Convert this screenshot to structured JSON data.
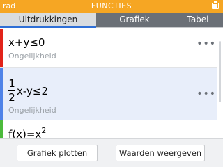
{
  "status": {
    "angle_mode": "rad",
    "app_title": "FUNCTIES",
    "battery_icon": "battery-icon"
  },
  "tabs": [
    {
      "label": "Uitdrukkingen",
      "active": true
    },
    {
      "label": "Grafiek",
      "active": false
    },
    {
      "label": "Tabel",
      "active": false
    }
  ],
  "expressions": [
    {
      "expression": "x+y≤0",
      "subtitle": "Ongelijkheid",
      "color": "#e2231a"
    },
    {
      "fraction": {
        "numerator": "1",
        "denominator": "2"
      },
      "expression": "x-y≤2",
      "subtitle": "Ongelijkheid",
      "color": "#4f83e8"
    },
    {
      "expression_base": "f(x)=x",
      "exponent": "2",
      "color": "#4cba3c"
    }
  ],
  "more_icon": "ellipsis-icon",
  "colors": {
    "header": "#f6a623",
    "tab_bar": "#6b7077",
    "selected_row": "#e8eefa"
  },
  "buttons": {
    "plot": "Grafiek plotten",
    "values": "Waarden weergeven"
  }
}
